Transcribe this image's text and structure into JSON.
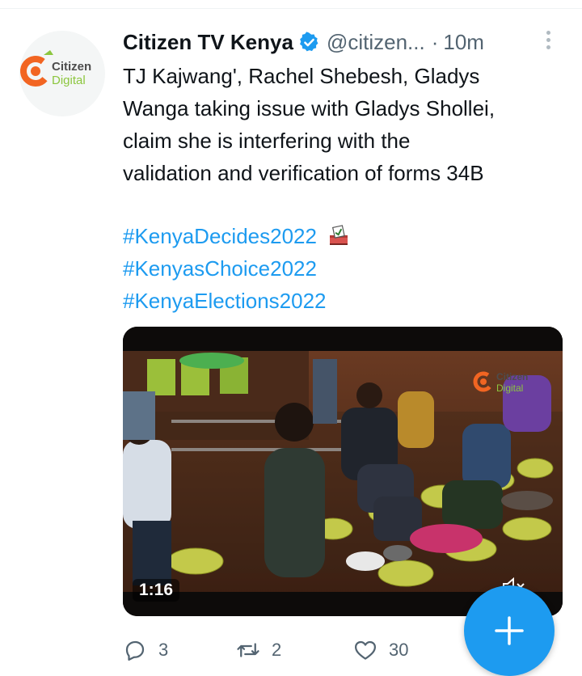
{
  "tweet": {
    "author": {
      "name": "Citizen TV Kenya",
      "handle": "@citizen...",
      "separator": "·",
      "time": "10m",
      "avatar_logo_line1": "Citizen",
      "avatar_logo_line2": "Digital"
    },
    "text_lines": [
      "TJ Kajwang', Rachel Shebesh, Gladys",
      "Wanga taking issue with Gladys Shollei,",
      "claim she is interfering with the",
      "validation and verification of forms 34B"
    ],
    "hashtags": [
      "#KenyaDecides2022",
      "#KenyasChoice2022",
      "#KenyaElections2022"
    ],
    "media": {
      "duration": "1:16",
      "watermark_line1": "Citizen",
      "watermark_line2": "Digital"
    },
    "actions": {
      "replies": "3",
      "retweets": "2",
      "likes": "30"
    }
  },
  "colors": {
    "accent": "#1d9bf0",
    "text": "#0f1419",
    "muted": "#536471",
    "brand_orange": "#f26522",
    "brand_green": "#8cc63f"
  },
  "icons": [
    "verified-badge-icon",
    "more-options-icon",
    "ballot-box-icon",
    "mute-icon",
    "reply-icon",
    "retweet-icon",
    "like-icon",
    "compose-plus-icon"
  ]
}
